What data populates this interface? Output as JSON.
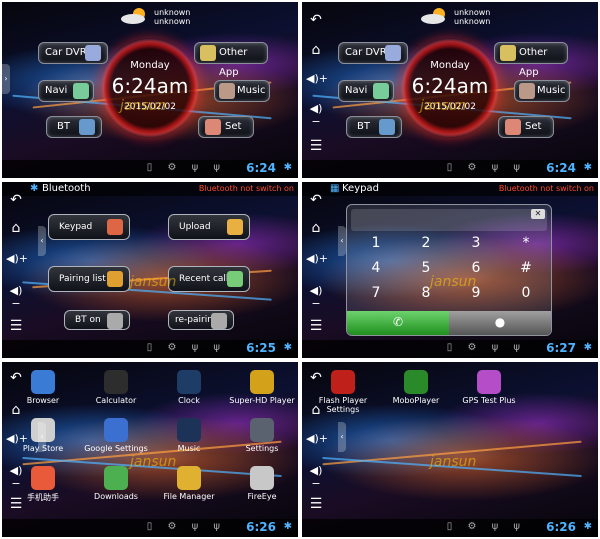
{
  "home": {
    "weather": {
      "line1": "unknown",
      "line2": "unknown"
    },
    "clock": {
      "day": "Monday",
      "time": "6:24am",
      "date": "2015/02/02"
    },
    "buttons": {
      "car_dvr": "Car DVR",
      "other_app": "Other App",
      "navi": "Navi",
      "music": "Music",
      "bt": "BT",
      "set": "Set"
    },
    "status_time": "6:24"
  },
  "bluetooth": {
    "title": "Bluetooth",
    "status": "Bluetooth not switch on",
    "buttons": {
      "keypad": "Keypad",
      "upload": "Upload",
      "pairing_list": "Pairing list",
      "recent_calls": "Recent calls",
      "bt_on": "BT on",
      "re_pairing": "re-pairing"
    },
    "status_time": "6:25"
  },
  "keypad": {
    "title": "Keypad",
    "status": "Bluetooth not switch on",
    "keys": [
      "1",
      "2",
      "3",
      "*",
      "4",
      "5",
      "6",
      "#",
      "7",
      "8",
      "9",
      "0"
    ],
    "status_time": "6:27"
  },
  "apps1": {
    "items": [
      {
        "label": "Browser",
        "color": "#3a7bd5"
      },
      {
        "label": "Calculator",
        "color": "#2d2d2d"
      },
      {
        "label": "Clock",
        "color": "#1d3c66"
      },
      {
        "label": "Super-HD Player",
        "color": "#d4a21a"
      },
      {
        "label": "Play Store",
        "color": "#cfcfcf"
      },
      {
        "label": "Google Settings",
        "color": "#3b6fd0"
      },
      {
        "label": "Music",
        "color": "#1c3357"
      },
      {
        "label": "Settings",
        "color": "#5a6270"
      },
      {
        "label": "手机助手",
        "color": "#e85a3a"
      },
      {
        "label": "Downloads",
        "color": "#4caf50"
      },
      {
        "label": "File Manager",
        "color": "#e0b030"
      },
      {
        "label": "FireEye",
        "color": "#c8c8c8"
      }
    ],
    "status_time": "6:26"
  },
  "apps2": {
    "items": [
      {
        "label": "Flash Player Settings",
        "color": "#c0201a"
      },
      {
        "label": "MoboPlayer",
        "color": "#2a8a2a"
      },
      {
        "label": "GPS Test Plus",
        "color": "#b54cc8"
      }
    ],
    "status_time": "6:26"
  },
  "watermark": "jansun",
  "colors": {
    "accent": "#4fb4ff",
    "warning": "#ff4a2a"
  }
}
